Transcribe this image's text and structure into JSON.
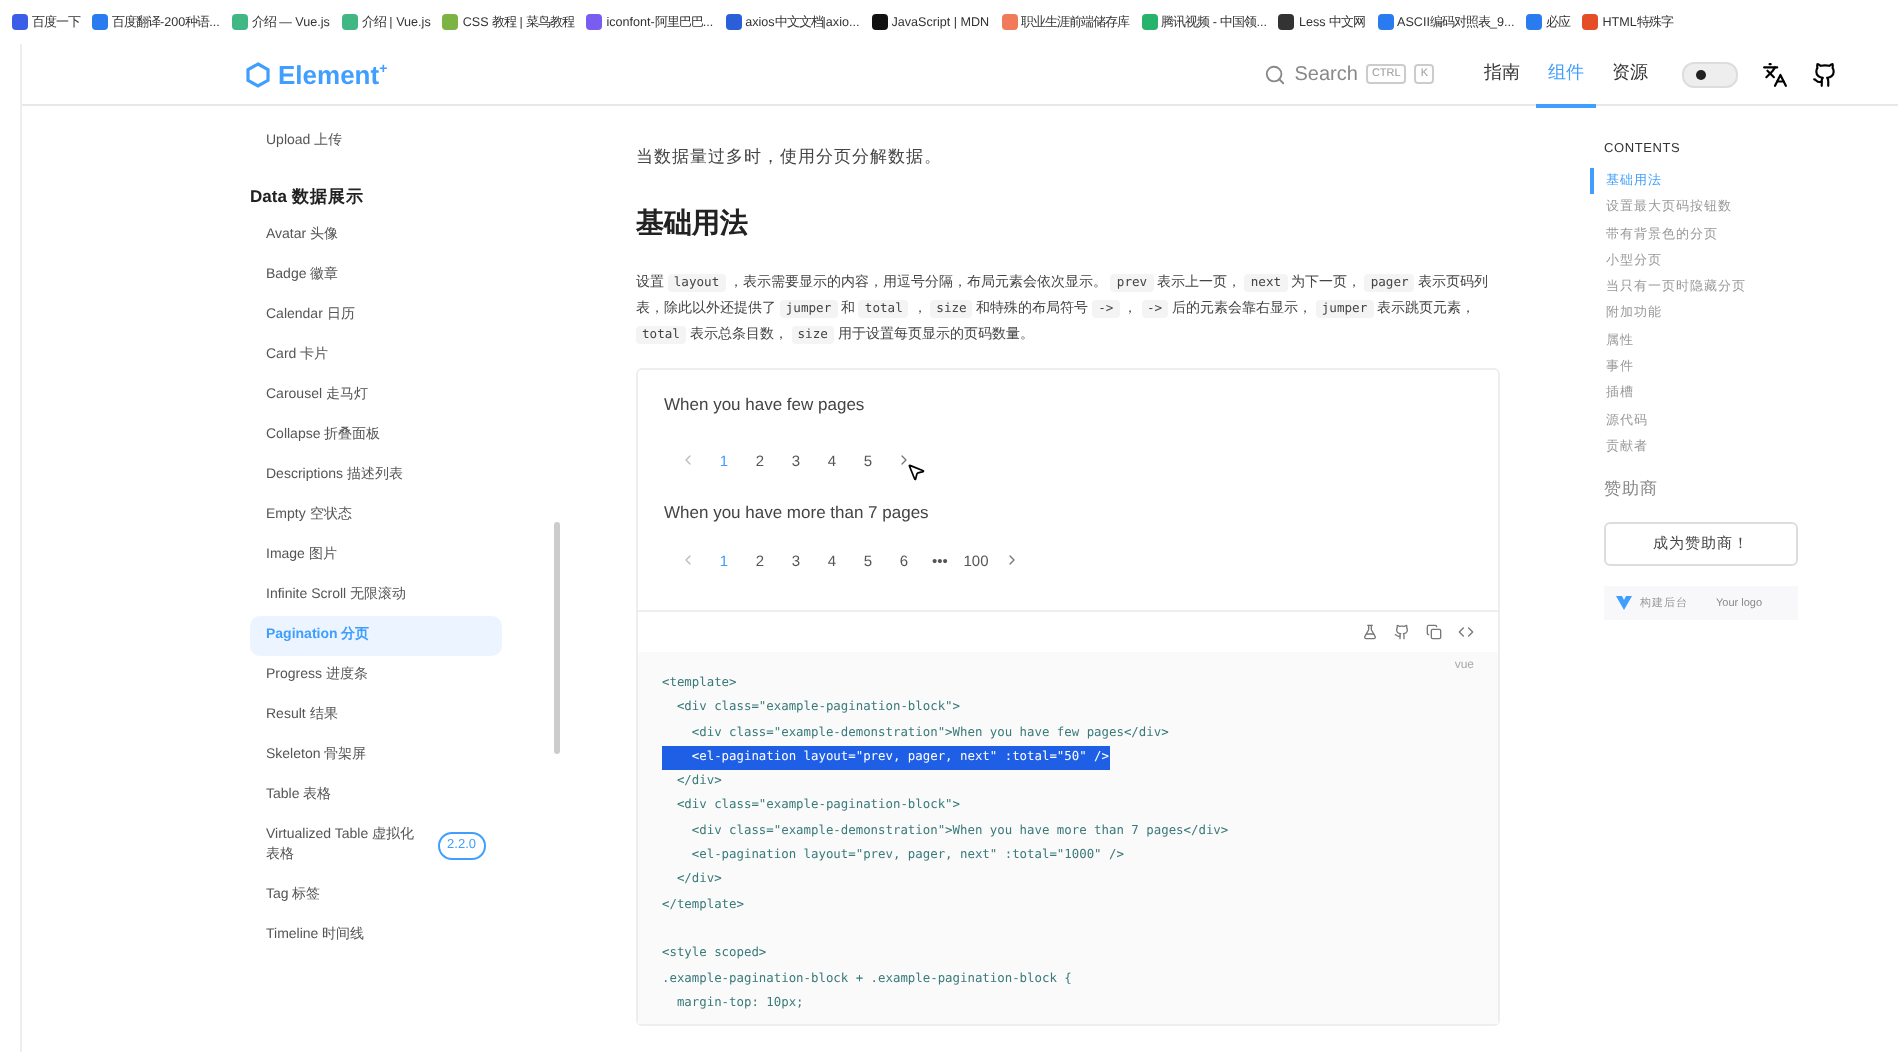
{
  "bookmarks": [
    {
      "label": "百度一下",
      "color": "#3a5ee8"
    },
    {
      "label": "百度翻译-200种语...",
      "color": "#2b7bf0"
    },
    {
      "label": "介绍 — Vue.js",
      "color": "#41b883"
    },
    {
      "label": "介绍 | Vue.js",
      "color": "#41b883"
    },
    {
      "label": "CSS 教程 | 菜鸟教程",
      "color": "#7cb342"
    },
    {
      "label": "iconfont-阿里巴巴...",
      "color": "#7b5cf0"
    },
    {
      "label": "axios中文文档|axio...",
      "color": "#2b5fd9"
    },
    {
      "label": "JavaScript | MDN",
      "color": "#111111"
    },
    {
      "label": "职业生涯前端储存库",
      "color": "#f07a5a"
    },
    {
      "label": "腾讯视频 - 中国领...",
      "color": "#26b36b"
    },
    {
      "label": "Less 中文网",
      "color": "#333333"
    },
    {
      "label": "ASCII编码对照表_9...",
      "color": "#2b7bf0"
    },
    {
      "label": "必应",
      "color": "#2b7bf0"
    },
    {
      "label": "HTML特殊字",
      "color": "#e44d26"
    }
  ],
  "header": {
    "logo": "Element",
    "logo_mark": "+",
    "search": {
      "placeholder": "Search",
      "keys": [
        "CTRL",
        "K"
      ]
    },
    "nav": [
      {
        "label": "指南",
        "selected": false
      },
      {
        "label": "组件",
        "selected": true
      },
      {
        "label": "资源",
        "selected": false
      }
    ],
    "dark_mode": false
  },
  "sidebar": {
    "items": [
      {
        "label": "Upload 上传",
        "kind": "item",
        "selected": false
      },
      {
        "label": "Data 数据展示",
        "kind": "group"
      },
      {
        "label": "Avatar 头像",
        "kind": "item",
        "selected": false
      },
      {
        "label": "Badge 徽章",
        "kind": "item",
        "selected": false
      },
      {
        "label": "Calendar 日历",
        "kind": "item",
        "selected": false
      },
      {
        "label": "Card 卡片",
        "kind": "item",
        "selected": false
      },
      {
        "label": "Carousel 走马灯",
        "kind": "item",
        "selected": false
      },
      {
        "label": "Collapse 折叠面板",
        "kind": "item",
        "selected": false
      },
      {
        "label": "Descriptions 描述列表",
        "kind": "item",
        "selected": false
      },
      {
        "label": "Empty 空状态",
        "kind": "item",
        "selected": false
      },
      {
        "label": "Image 图片",
        "kind": "item",
        "selected": false
      },
      {
        "label": "Infinite Scroll 无限滚动",
        "kind": "item",
        "selected": false
      },
      {
        "label": "Pagination 分页",
        "kind": "item",
        "selected": true
      },
      {
        "label": "Progress 进度条",
        "kind": "item",
        "selected": false
      },
      {
        "label": "Result 结果",
        "kind": "item",
        "selected": false
      },
      {
        "label": "Skeleton 骨架屏",
        "kind": "item",
        "selected": false
      },
      {
        "label": "Table 表格",
        "kind": "item",
        "selected": false
      },
      {
        "label": "Virtualized Table 虚拟化表格",
        "kind": "item",
        "selected": false,
        "badge": "2.2.0"
      },
      {
        "label": "Tag 标签",
        "kind": "item",
        "selected": false
      },
      {
        "label": "Timeline 时间线",
        "kind": "item",
        "selected": false
      }
    ]
  },
  "main": {
    "lead": "当数据量过多时，使用分页分解数据。",
    "heading": "基础用法",
    "description": [
      {
        "text": "设置 ",
        "kind": "text"
      },
      {
        "text": "layout",
        "kind": "code"
      },
      {
        "text": " ，表示需要显示的内容，用逗号分隔，布局元素会依次显示。 ",
        "kind": "text"
      },
      {
        "text": "prev",
        "kind": "code"
      },
      {
        "text": " 表示上一页， ",
        "kind": "text"
      },
      {
        "text": "next",
        "kind": "code"
      },
      {
        "text": " 为下一页， ",
        "kind": "text"
      },
      {
        "text": "pager",
        "kind": "code"
      },
      {
        "text": " 表示页码列表，除此以外还提供了 ",
        "kind": "text"
      },
      {
        "text": "jumper",
        "kind": "code"
      },
      {
        "text": " 和 ",
        "kind": "text"
      },
      {
        "text": "total",
        "kind": "code"
      },
      {
        "text": " ， ",
        "kind": "text"
      },
      {
        "text": "size",
        "kind": "code"
      },
      {
        "text": " 和特殊的布局符号 ",
        "kind": "text"
      },
      {
        "text": "->",
        "kind": "code"
      },
      {
        "text": " ， ",
        "kind": "text"
      },
      {
        "text": "->",
        "kind": "code"
      },
      {
        "text": " 后的元素会靠右显示， ",
        "kind": "text"
      },
      {
        "text": "jumper",
        "kind": "code"
      },
      {
        "text": " 表示跳页元素， ",
        "kind": "text"
      },
      {
        "text": "total",
        "kind": "code"
      },
      {
        "text": " 表示总条目数， ",
        "kind": "text"
      },
      {
        "text": "size",
        "kind": "code"
      },
      {
        "text": " 用于设置每页显示的页码数量。",
        "kind": "text"
      }
    ],
    "demo": [
      {
        "caption": "When you have few pages",
        "pages": [
          {
            "label": "1",
            "selected": true
          },
          {
            "label": "2",
            "selected": false
          },
          {
            "label": "3",
            "selected": false
          },
          {
            "label": "4",
            "selected": false
          },
          {
            "label": "5",
            "selected": false
          }
        ]
      },
      {
        "caption": "When you have more than 7 pages",
        "pages": [
          {
            "label": "1",
            "selected": true
          },
          {
            "label": "2",
            "selected": false
          },
          {
            "label": "3",
            "selected": false
          },
          {
            "label": "4",
            "selected": false
          },
          {
            "label": "5",
            "selected": false
          },
          {
            "label": "6",
            "selected": false
          },
          {
            "label": "•••",
            "selected": false
          },
          {
            "label": "100",
            "selected": false
          }
        ]
      }
    ],
    "code_lang": "vue",
    "code": [
      {
        "kind": "line",
        "text": "<template>"
      },
      {
        "kind": "line",
        "text": "  <div class=\"example-pagination-block\">"
      },
      {
        "kind": "line",
        "text": "    <div class=\"example-demonstration\">When you have few pages</div>"
      },
      {
        "kind": "line",
        "text": "    <el-pagination layout=\"prev, pager, next\" :total=\"50\" />",
        "highlighted": true
      },
      {
        "kind": "line",
        "text": "  </div>"
      },
      {
        "kind": "line",
        "text": "  <div class=\"example-pagination-block\">"
      },
      {
        "kind": "line",
        "text": "    <div class=\"example-demonstration\">When you have more than 7 pages</div>"
      },
      {
        "kind": "line",
        "text": "    <el-pagination layout=\"prev, pager, next\" :total=\"1000\" />"
      },
      {
        "kind": "line",
        "text": "  </div>"
      },
      {
        "kind": "line",
        "text": "</template>"
      },
      {
        "kind": "blank"
      },
      {
        "kind": "line",
        "text": "<style scoped>"
      },
      {
        "kind": "line",
        "text": ".example-pagination-block + .example-pagination-block {"
      },
      {
        "kind": "line",
        "text": "  margin-top: 10px;"
      }
    ]
  },
  "toc": {
    "title": "CONTENTS",
    "items": [
      {
        "label": "基础用法",
        "selected": true
      },
      {
        "label": "设置最大页码按钮数",
        "selected": false
      },
      {
        "label": "带有背景色的分页",
        "selected": false
      },
      {
        "label": "小型分页",
        "selected": false
      },
      {
        "label": "当只有一页时隐藏分页",
        "selected": false
      },
      {
        "label": "附加功能",
        "selected": false
      },
      {
        "label": "属性",
        "selected": false
      },
      {
        "label": "事件",
        "selected": false
      },
      {
        "label": "插槽",
        "selected": false
      },
      {
        "label": "源代码",
        "selected": false
      },
      {
        "label": "贡献者",
        "selected": false
      }
    ],
    "sponsor_title": "赞助商",
    "sponsor_button": "成为赞助商！",
    "sponsor_ad": {
      "name": "构建后台",
      "slot": "Your logo"
    }
  }
}
